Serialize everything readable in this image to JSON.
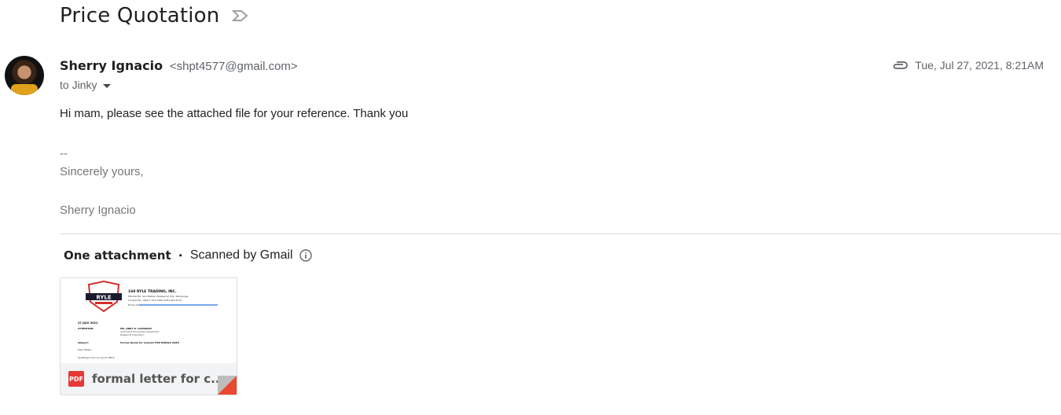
{
  "subject": "Price Quotation",
  "sender": {
    "name": "Sherry Ignacio",
    "email": "<shpt4577@gmail.com>"
  },
  "recipient": "to Jinky",
  "date": "Tue, Jul 27, 2021, 8:21AM",
  "body": "Hi mam, please see the attached file for your reference. Thank you",
  "signature": {
    "dashes": "--",
    "closing": "Sincerely yours,",
    "name": "Sherry Ignacio"
  },
  "attachments": {
    "title": "One attachment",
    "separator": "•",
    "scanned": "Scanned by Gmail",
    "items": [
      {
        "type": "PDF",
        "name": "formal letter for c...",
        "preview": {
          "company": "168 RYLE TRADING, INC.",
          "address": "Plaridel Rd. San Matias, Mabalacat City, Pampanga",
          "contact": "Contact No. (0917) 123 0180 (045) 923-4712",
          "email_label": "Email Add:",
          "date": "27 JULY 2021",
          "attention_label": "ATTENTION:",
          "attention_name": "MS. JINKY R. OLEARIBIA",
          "attention_dept": "Contracts & Procurement Department",
          "attention_company": "Megaworld Corporation",
          "subject_label": "Subject:",
          "subject_value": "Formal Quote for Cement FOR MANILA AREA",
          "salutation": "Dear Maam,",
          "greeting": "Greetings from our good office!"
        }
      }
    ]
  },
  "colors": {
    "pdf_red": "#e53935",
    "fold_red": "#e8492f",
    "signature_gray": "#777777"
  }
}
